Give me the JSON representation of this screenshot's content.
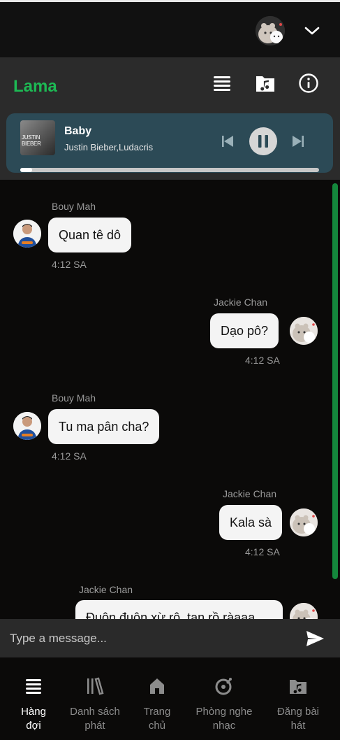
{
  "header": {
    "user_avatar_icon": "cat-avatar-icon",
    "menu_icon": "chevron-down-icon"
  },
  "room": {
    "title": "Lama",
    "actions": [
      "queue-icon",
      "music-folder-icon",
      "info-icon"
    ]
  },
  "player": {
    "title": "Baby",
    "artist": "Justin Bieber,Ludacris",
    "cover_text": "JUSTIN BIEBER",
    "progress": 0.04
  },
  "messages": [
    {
      "sender": "Bouy Mah",
      "text": "Quan tê dô",
      "time": "4:12 SA",
      "side": "left"
    },
    {
      "sender": "Jackie Chan",
      "text": "Dạo pô?",
      "time": "4:12 SA",
      "side": "right"
    },
    {
      "sender": "Bouy Mah",
      "text": "Tu ma pân cha?",
      "time": "4:12 SA",
      "side": "left"
    },
    {
      "sender": "Jackie Chan",
      "text": "Kala sà",
      "time": "4:12 SA",
      "side": "right"
    },
    {
      "sender": "Jackie Chan",
      "text": "Đuộn đuộn xừ rô, tạn rồ ràaaa",
      "time": "",
      "side": "right"
    }
  ],
  "composer": {
    "placeholder": "Type a message..."
  },
  "nav": {
    "items": [
      {
        "label1": "Hàng",
        "label2": "đợi",
        "active": true
      },
      {
        "label1": "Danh sách",
        "label2": "phát",
        "active": false
      },
      {
        "label1": "Trang",
        "label2": "chủ",
        "active": false
      },
      {
        "label1": "Phòng nghe",
        "label2": "nhạc",
        "active": false
      },
      {
        "label1": "Đăng bài",
        "label2": "hát",
        "active": false
      }
    ]
  },
  "colors": {
    "accent": "#1db954",
    "player_bg": "#2c4a56",
    "scrollbar": "#14873c"
  }
}
